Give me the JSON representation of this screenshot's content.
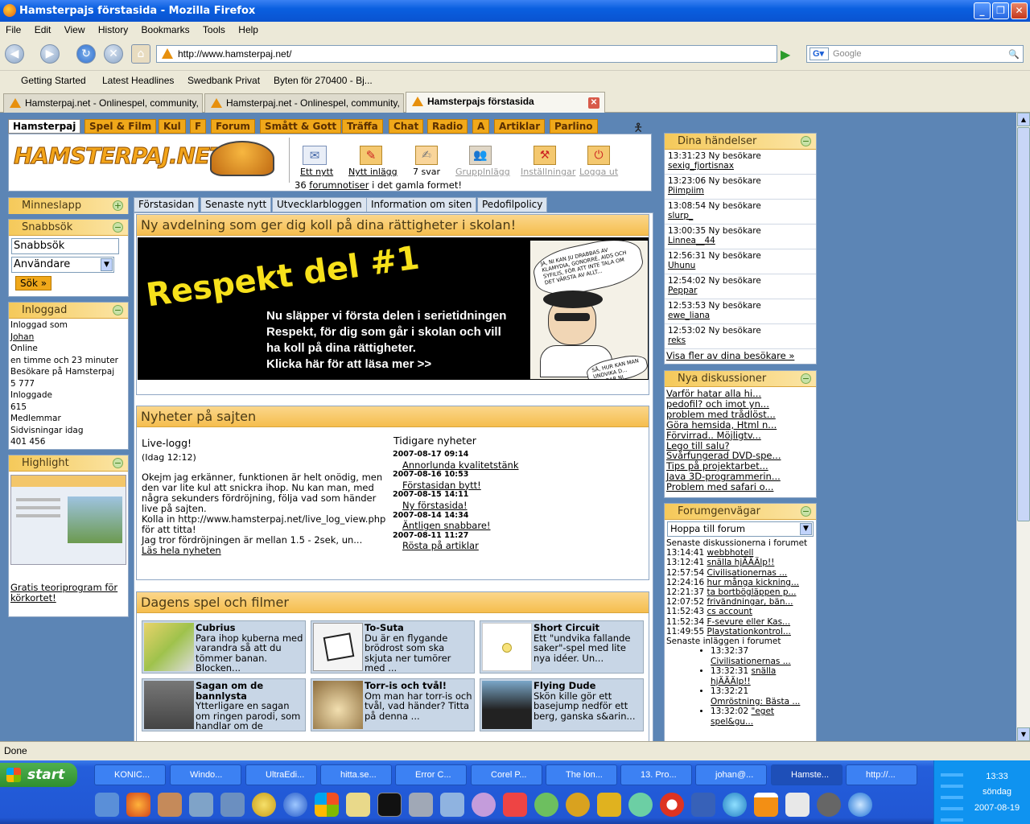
{
  "window": {
    "title": "Hamsterpajs förstasida - Mozilla Firefox"
  },
  "menu": [
    "File",
    "Edit",
    "View",
    "History",
    "Bookmarks",
    "Tools",
    "Help"
  ],
  "url": "http://www.hamsterpaj.net/",
  "search_placeholder": "Google",
  "bookmarks": [
    "Getting Started",
    "Latest Headlines",
    "Swedbank Privat",
    "Byten för 270400 - Bj..."
  ],
  "tabs": [
    "Hamsterpaj.net - Onlinespel, community, ...",
    "Hamsterpaj.net - Onlinespel, community, ...",
    "Hamsterpajs förstasida"
  ],
  "site": {
    "nav": [
      "Hamsterpaj",
      "Spel & Film",
      "Kul",
      "F",
      "Forum",
      "Smått & Gott",
      "Träffa",
      "Chat",
      "Radio",
      "A",
      "Artiklar",
      "Parlino"
    ],
    "logo": "HAMSTERPAJ.NET",
    "actions": [
      "Ett nytt",
      "Nytt inlägg",
      "7 svar",
      "Grupplnlägg",
      "Inställningar",
      "Logga ut"
    ],
    "forum_notice_count": "36",
    "forum_notice_link": "forumnotiser",
    "forum_notice_rest": "i det gamla formet!",
    "page_tabs": [
      "Förstasidan",
      "Senaste nytt",
      "Utvecklarbloggen",
      "Information om siten",
      "Pedofilpolicy"
    ],
    "left": {
      "minneslapp": "Minneslapp",
      "snabbsok": "Snabbsök",
      "snabbsok_input": "Snabbsök",
      "snabbsok_select": "Användare",
      "sok_button": "Sök »",
      "inloggad_title": "Inloggad",
      "inloggad_lines": [
        "Inloggad som",
        "Johan",
        "Online",
        "en timme och 23 minuter",
        "Besökare på Hamsterpaj",
        "5 777",
        "Inloggade",
        "615",
        "Medlemmar",
        "Sidvisningar idag",
        "401 456"
      ],
      "highlight_title": "Highlight",
      "highlight_link": "Gratis teoriprogram för körkortet!"
    },
    "banner": {
      "title": "Ny avdelning som ger dig koll på dina rättigheter i skolan!",
      "headline": "Respekt del #1",
      "body": [
        "Nu släpper vi första delen i serietidningen",
        "Respekt, för dig som går i skolan och vill",
        "ha koll på dina rättigheter.",
        "Klicka här för att läsa mer >>"
      ],
      "bubble1": "JA, NI KAN JU DRABBAS AV KLAMYDIA, GONORRÉ, AIDS OCH SYFILIS, FÖR ATT INTE TALA OM DET VÄRSTA AV ALLT...",
      "bubble2": "SÅ, HUR KAN MAN UNDVIKA D... UNDRAR NI FÖRSTÅS!"
    },
    "news": {
      "title": "Nyheter på sajten",
      "item_title": "Live-logg!",
      "item_date": "(Idag 12:12)",
      "item_body": "Okejm jag erkänner, funktionen är helt onödig, men den var lite kul att snickra ihop. Nu kan man, med några sekunders fördröjning, följa vad som händer live på sajten.\nKolla in http://www.hamsterpaj.net/live_log_view.php för att titta!\nJag tror fördröjningen är mellan 1.5 - 2sek, un...",
      "read_more": "Läs hela nyheten",
      "older_title": "Tidigare nyheter",
      "older": [
        {
          "date": "2007-08-17 09:14",
          "title": "Annorlunda kvalitetstänk"
        },
        {
          "date": "2007-08-16 10:53",
          "title": "Förstasidan bytt!"
        },
        {
          "date": "2007-08-15 14:11",
          "title": "Ny förstasida!"
        },
        {
          "date": "2007-08-14 14:34",
          "title": "Äntligen snabbare!"
        },
        {
          "date": "2007-08-11 11:27",
          "title": "Rösta på artiklar"
        }
      ]
    },
    "games": {
      "title": "Dagens spel och filmer",
      "items": [
        {
          "title": "Cubrius",
          "desc": "Para ihop kuberna med varandra så att du tömmer banan. Blocken..."
        },
        {
          "title": "To-Suta",
          "desc": "Du är en flygande brödrost som ska skjuta ner tumörer med ..."
        },
        {
          "title": "Short Circuit",
          "desc": "Ett \"undvika fallande saker\"-spel med lite nya idéer. Un..."
        },
        {
          "title": "Sagan om de bannlysta",
          "desc": "Ytterligare en sagan om ringen parodi, som handlar om de"
        },
        {
          "title": "Torr-is och tvål!",
          "desc": "Om man har torr-is och tvål, vad händer? Titta på denna ..."
        },
        {
          "title": "Flying Dude",
          "desc": "Skön kille gör ett basejump nedför ett berg, ganska s&arin..."
        }
      ]
    },
    "events": {
      "title": "Dina händelser",
      "items": [
        {
          "time": "13:31:23",
          "text": "Ny besökare",
          "user": "sexig_fjortisnax"
        },
        {
          "time": "13:23:06",
          "text": "Ny besökare",
          "user": "Piimpiim"
        },
        {
          "time": "13:08:54",
          "text": "Ny besökare",
          "user": "slurp_"
        },
        {
          "time": "13:00:35",
          "text": "Ny besökare",
          "user": "Linnea__44"
        },
        {
          "time": "12:56:31",
          "text": "Ny besökare",
          "user": "Uhunu"
        },
        {
          "time": "12:54:02",
          "text": "Ny besökare",
          "user": "Peppar"
        },
        {
          "time": "12:53:53",
          "text": "Ny besökare",
          "user": "ewe_liana"
        },
        {
          "time": "12:53:02",
          "text": "Ny besökare",
          "user": "reks"
        }
      ],
      "more": "Visa fler av dina besökare »"
    },
    "discussions": {
      "title": "Nya diskussioner",
      "items": [
        "Varför hatar alla hi...",
        "pedofil? och imot yn...",
        "problem med trådlöst...",
        "Göra hemsida, Html n...",
        "Förvirrad.. Möjligtv...",
        "Lego till salu?",
        "Svårfungerad DVD-spe...",
        "Tips på projektarbet...",
        "Java 3D-programmerin...",
        "Problem med safari o..."
      ]
    },
    "forum": {
      "title": "Forumgenvägar",
      "select": "Hoppa till forum",
      "latest_label": "Senaste diskussionerna i forumet",
      "latest": [
        {
          "time": "13:14:41",
          "title": "webbhotell"
        },
        {
          "time": "13:12:41",
          "title": "snälla hjÄÄÄlp!!"
        },
        {
          "time": "12:57:54",
          "title": "Civilisationernas ..."
        },
        {
          "time": "12:24:16",
          "title": "hur många kickning..."
        },
        {
          "time": "12:21:37",
          "title": "ta bortbögläppen p..."
        },
        {
          "time": "12:07:52",
          "title": "frivändningar, bän..."
        },
        {
          "time": "11:52:43",
          "title": "cs account"
        },
        {
          "time": "11:52:34",
          "title": "F-sevure eller Kas..."
        },
        {
          "time": "11:49:55",
          "title": "Playstationkontrol..."
        }
      ],
      "posts_label": "Senaste inläggen i forumet",
      "posts": [
        {
          "time": "13:32:37",
          "title": "Civilisationernas ..."
        },
        {
          "time": "13:32:31",
          "title": "snälla hjÄÄÄlp!!"
        },
        {
          "time": "13:32:21",
          "title": "Omröstning: Bästa ..."
        },
        {
          "time": "13:32:02",
          "title": "\"eget spel&gu..."
        }
      ]
    }
  },
  "status": "Done",
  "taskbar": {
    "start": "start",
    "tasks": [
      "KONIC...",
      "Windo...",
      "UltraEdi...",
      "hitta.se...",
      "Error C...",
      "Corel P...",
      "The lon...",
      "13. Pro...",
      "johan@...",
      "Hamste...",
      "http://..."
    ],
    "time": "13:33",
    "day": "söndag",
    "date": "2007-08-19"
  }
}
